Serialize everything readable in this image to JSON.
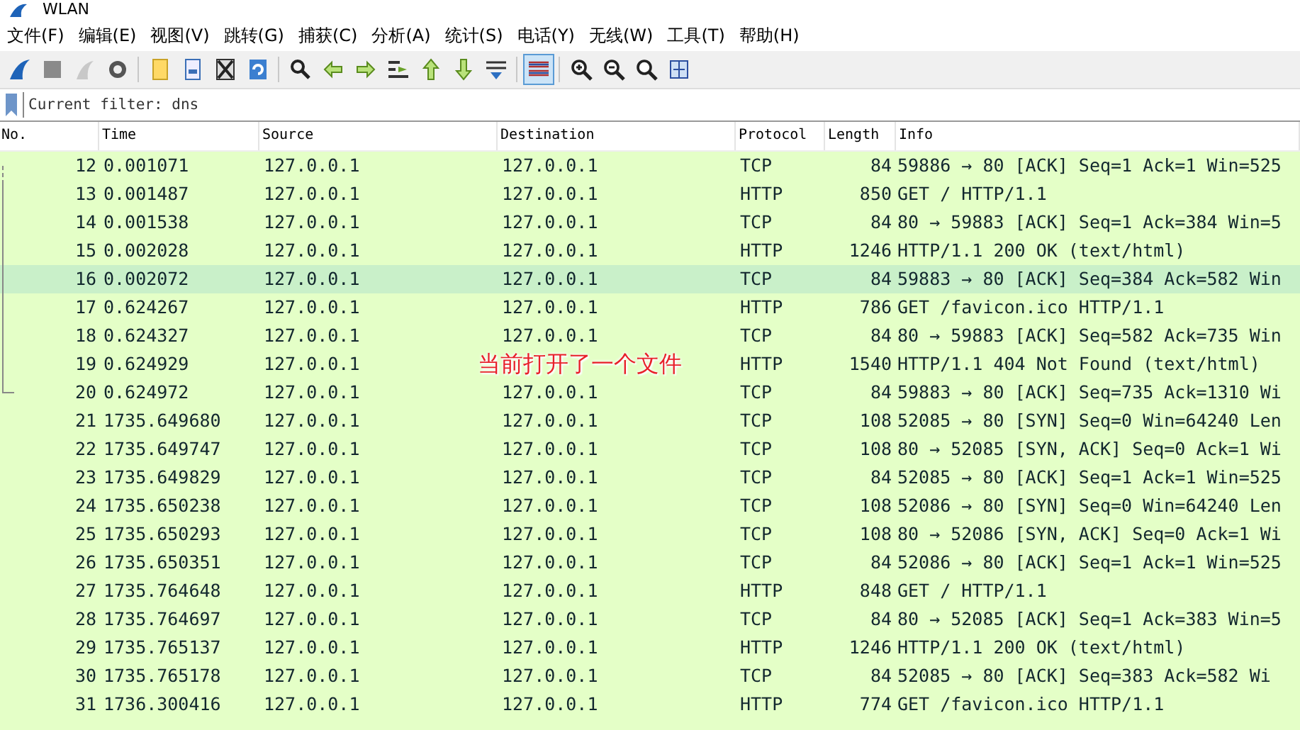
{
  "window": {
    "title": "WLAN"
  },
  "menu": [
    "文件(F)",
    "编辑(E)",
    "视图(V)",
    "跳转(G)",
    "捕获(C)",
    "分析(A)",
    "统计(S)",
    "电话(Y)",
    "无线(W)",
    "工具(T)",
    "帮助(H)"
  ],
  "toolbar_buttons": [
    {
      "selected": false
    },
    {
      "selected": false
    },
    {
      "selected": false
    },
    {
      "selected": false
    },
    {
      "selected": false
    },
    {
      "selected": false
    },
    {
      "selected": false
    },
    {
      "selected": false
    },
    {
      "selected": false
    },
    {
      "selected": false
    },
    {
      "selected": false
    },
    {
      "selected": false
    },
    {
      "selected": false
    },
    {
      "selected": false
    },
    {
      "selected": false
    },
    {
      "selected": true
    },
    {
      "selected": false
    },
    {
      "selected": false
    },
    {
      "selected": false
    },
    {
      "selected": false
    }
  ],
  "filter": {
    "value": "Current filter: dns"
  },
  "table": {
    "columns": [
      "No.",
      "Time",
      "Source",
      "Destination",
      "Protocol",
      "Length",
      "Info"
    ],
    "rows": [
      {
        "no": "12",
        "time": "0.001071",
        "source": "127.0.0.1",
        "destination": "127.0.0.1",
        "protocol": "TCP",
        "length": "84",
        "info": "59886 → 80 [ACK] Seq=1 Ack=1 Win=525",
        "selected": false,
        "kind": "start"
      },
      {
        "no": "13",
        "time": "0.001487",
        "source": "127.0.0.1",
        "destination": "127.0.0.1",
        "protocol": "HTTP",
        "length": "850",
        "info": "GET / HTTP/1.1",
        "selected": false,
        "kind": "middle"
      },
      {
        "no": "14",
        "time": "0.001538",
        "source": "127.0.0.1",
        "destination": "127.0.0.1",
        "protocol": "TCP",
        "length": "84",
        "info": "80 → 59883 [ACK] Seq=1 Ack=384 Win=5",
        "selected": false,
        "kind": "middle"
      },
      {
        "no": "15",
        "time": "0.002028",
        "source": "127.0.0.1",
        "destination": "127.0.0.1",
        "protocol": "HTTP",
        "length": "1246",
        "info": "HTTP/1.1 200 OK  (text/html)",
        "selected": false,
        "kind": "middle"
      },
      {
        "no": "16",
        "time": "0.002072",
        "source": "127.0.0.1",
        "destination": "127.0.0.1",
        "protocol": "TCP",
        "length": "84",
        "info": "59883 → 80 [ACK] Seq=384 Ack=582 Win",
        "selected": true,
        "kind": "middle"
      },
      {
        "no": "17",
        "time": "0.624267",
        "source": "127.0.0.1",
        "destination": "127.0.0.1",
        "protocol": "HTTP",
        "length": "786",
        "info": "GET /favicon.ico HTTP/1.1",
        "selected": false,
        "kind": "middle"
      },
      {
        "no": "18",
        "time": "0.624327",
        "source": "127.0.0.1",
        "destination": "127.0.0.1",
        "protocol": "TCP",
        "length": "84",
        "info": "80 → 59883 [ACK] Seq=582 Ack=735 Win",
        "selected": false,
        "kind": "middle"
      },
      {
        "no": "19",
        "time": "0.624929",
        "source": "127.0.0.1",
        "annotation": "当前打开了一个文件",
        "protocol": "HTTP",
        "length": "1540",
        "info": "HTTP/1.1 404 Not Found  (text/html)",
        "selected": false,
        "kind": "middle"
      },
      {
        "no": "20",
        "time": "0.624972",
        "source": "127.0.0.1",
        "destination": "127.0.0.1",
        "protocol": "TCP",
        "length": "84",
        "info": "59883 → 80 [ACK] Seq=735 Ack=1310 Wi",
        "selected": false,
        "kind": "end"
      },
      {
        "no": "21",
        "time": "1735.649680",
        "source": "127.0.0.1",
        "destination": "127.0.0.1",
        "protocol": "TCP",
        "length": "108",
        "info": "52085 → 80 [SYN] Seq=0 Win=64240 Len",
        "selected": false
      },
      {
        "no": "22",
        "time": "1735.649747",
        "source": "127.0.0.1",
        "destination": "127.0.0.1",
        "protocol": "TCP",
        "length": "108",
        "info": "80 → 52085 [SYN, ACK] Seq=0 Ack=1 Wi",
        "selected": false
      },
      {
        "no": "23",
        "time": "1735.649829",
        "source": "127.0.0.1",
        "destination": "127.0.0.1",
        "protocol": "TCP",
        "length": "84",
        "info": "52085 → 80 [ACK] Seq=1 Ack=1 Win=525",
        "selected": false
      },
      {
        "no": "24",
        "time": "1735.650238",
        "source": "127.0.0.1",
        "destination": "127.0.0.1",
        "protocol": "TCP",
        "length": "108",
        "info": "52086 → 80 [SYN] Seq=0 Win=64240 Len",
        "selected": false
      },
      {
        "no": "25",
        "time": "1735.650293",
        "source": "127.0.0.1",
        "destination": "127.0.0.1",
        "protocol": "TCP",
        "length": "108",
        "info": "80 → 52086 [SYN, ACK] Seq=0 Ack=1 Wi",
        "selected": false
      },
      {
        "no": "26",
        "time": "1735.650351",
        "source": "127.0.0.1",
        "destination": "127.0.0.1",
        "protocol": "TCP",
        "length": "84",
        "info": "52086 → 80 [ACK] Seq=1 Ack=1 Win=525",
        "selected": false
      },
      {
        "no": "27",
        "time": "1735.764648",
        "source": "127.0.0.1",
        "destination": "127.0.0.1",
        "protocol": "HTTP",
        "length": "848",
        "info": "GET / HTTP/1.1",
        "selected": false
      },
      {
        "no": "28",
        "time": "1735.764697",
        "source": "127.0.0.1",
        "destination": "127.0.0.1",
        "protocol": "TCP",
        "length": "84",
        "info": "80 → 52085 [ACK] Seq=1 Ack=383 Win=5",
        "selected": false
      },
      {
        "no": "29",
        "time": "1735.765137",
        "source": "127.0.0.1",
        "destination": "127.0.0.1",
        "protocol": "HTTP",
        "length": "1246",
        "info": "HTTP/1.1 200 OK  (text/html)",
        "selected": false
      },
      {
        "no": "30",
        "time": "1735.765178",
        "source": "127.0.0.1",
        "destination": "127.0.0.1",
        "protocol": "TCP",
        "length": "84",
        "info": "52085 → 80 [ACK] Seq=383 Ack=582 Wi",
        "selected": false
      },
      {
        "no": "31",
        "time": "1736.300416",
        "source": "127.0.0.1",
        "destination": "127.0.0.1",
        "protocol": "HTTP",
        "length": "774",
        "info": "GET /favicon.ico HTTP/1.1",
        "selected": false
      }
    ]
  }
}
